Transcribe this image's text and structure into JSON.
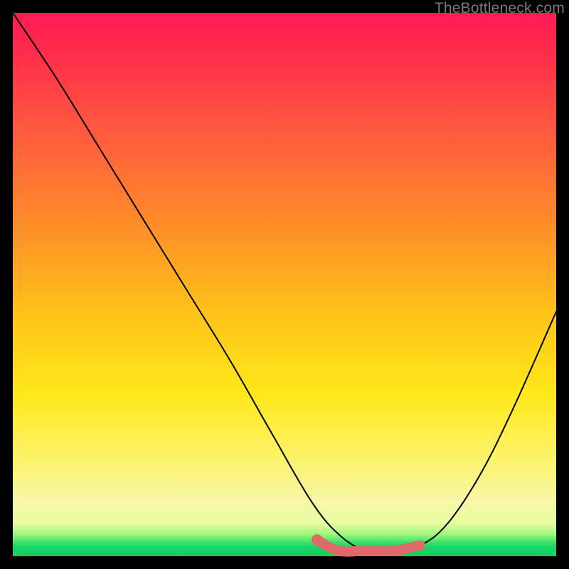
{
  "watermark": "TheBottleneck.com",
  "chart_data": {
    "type": "line",
    "title": "",
    "xlabel": "",
    "ylabel": "",
    "xlim": [
      0,
      100
    ],
    "ylim": [
      0,
      100
    ],
    "grid": false,
    "legend": false,
    "series": [
      {
        "name": "bottleneck-curve",
        "x": [
          0,
          8,
          16,
          24,
          32,
          40,
          48,
          55,
          60,
          65,
          70,
          75,
          80,
          86,
          92,
          100
        ],
        "values": [
          100,
          88,
          75,
          62,
          49,
          36,
          22,
          10,
          4,
          1,
          1,
          2,
          6,
          15,
          27,
          45
        ]
      },
      {
        "name": "optimal-range-highlight",
        "x": [
          56,
          60,
          65,
          70,
          75
        ],
        "values": [
          3,
          1,
          1,
          1,
          2
        ]
      }
    ],
    "annotations": [
      {
        "name": "optimal-start-dot",
        "x": 56,
        "y": 3
      }
    ]
  }
}
